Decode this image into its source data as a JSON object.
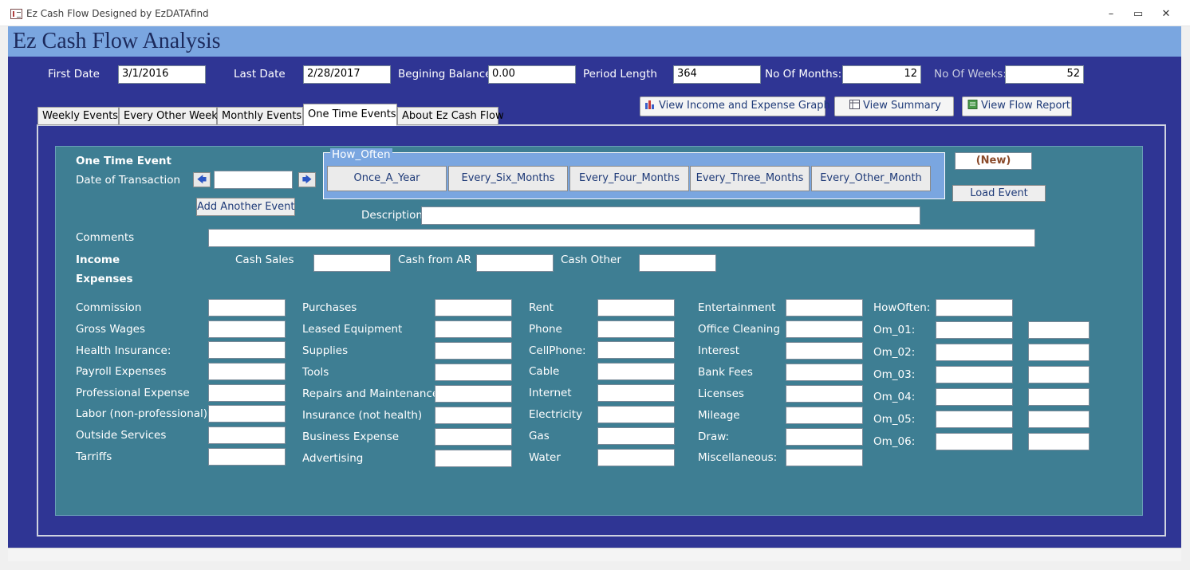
{
  "window": {
    "title": "Ez Cash Flow Designed by EzDATAfind",
    "minimize": "–",
    "maximize": "▭",
    "close": "✕"
  },
  "header": {
    "title": "Ez Cash Flow Analysis"
  },
  "params": {
    "first_date_label": "First Date",
    "first_date": "3/1/2016",
    "last_date_label": "Last Date",
    "last_date": "2/28/2017",
    "begin_balance_label": "Begining Balance",
    "begin_balance": "0.00",
    "period_length_label": "Period Length",
    "period_length": "364",
    "months_label": "No Of Months:",
    "months": "12",
    "weeks_label": "No Of Weeks:",
    "weeks": "52"
  },
  "tabs": [
    "Weekly Events",
    "Every Other Week",
    "Monthly Events",
    "One Time Events",
    "About Ez Cash Flow"
  ],
  "toolbar": {
    "graph": "View Income and Expense Graph",
    "summary": "View Summary",
    "report": "View Flow Report"
  },
  "event": {
    "heading": "One Time Event",
    "date_label": "Date of Transaction",
    "date_value": "",
    "prev_icon": "🡄",
    "next_icon": "🡆",
    "add_button": "Add Another Event",
    "how_often_label": "How_Often",
    "how_often_buttons": [
      "Once_A_Year",
      "Every_Six_Months",
      "Every_Four_Months",
      "Every_Three_Months",
      "Every_Other_Month"
    ],
    "record_status": "(New)",
    "load_button": "Load Event",
    "description_label": "Description",
    "comments_label": "Comments"
  },
  "income": {
    "label": "Income",
    "cash_sales": "Cash Sales",
    "cash_ar": "Cash from AR",
    "cash_other": "Cash Other"
  },
  "expenses": {
    "label": "Expenses",
    "col1": [
      "Commission",
      "Gross Wages",
      "Health Insurance:",
      "Payroll Expenses",
      "Professional Expense",
      "Labor (non-professional)",
      "Outside Services",
      "Tarriffs"
    ],
    "col2": [
      "Purchases",
      "Leased Equipment",
      "Supplies",
      "Tools",
      "Repairs and Maintenance",
      "Insurance (not health)",
      "Business Expense",
      "Advertising"
    ],
    "col3": [
      "Rent",
      "Phone",
      "CellPhone:",
      "Cable",
      "Internet",
      "Electricity",
      "Gas",
      "Water"
    ],
    "col4": [
      "Entertainment",
      "Office Cleaning",
      "Interest",
      "Bank Fees",
      "Licenses",
      "Mileage",
      "Draw:",
      "Miscellaneous:"
    ]
  },
  "other_months": {
    "how_often_label": "HowOften:",
    "rows": [
      "Om_01:",
      "Om_02:",
      "Om_03:",
      "Om_04:",
      "Om_05:",
      "Om_06:"
    ]
  }
}
